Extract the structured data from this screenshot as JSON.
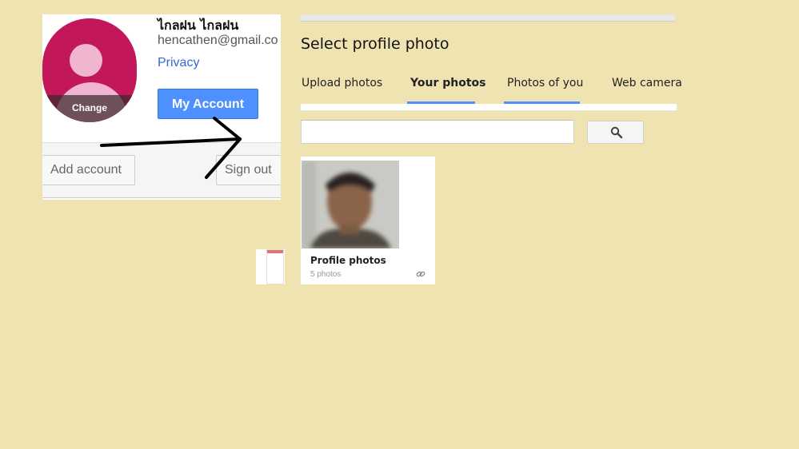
{
  "account": {
    "name": "ไกลฝน ไกลฝน",
    "email": "hencathen@gmail.co",
    "privacy_label": "Privacy",
    "my_account_label": "My Account",
    "avatar_change_label": "Change",
    "add_account_label": "Add account",
    "sign_out_label": "Sign out"
  },
  "dialog": {
    "title": "Select profile photo",
    "tabs": [
      {
        "label": "Upload photos",
        "active": false
      },
      {
        "label": "Your photos",
        "active": true
      },
      {
        "label": "Photos of you",
        "active": false
      },
      {
        "label": "Web camera",
        "active": false
      }
    ],
    "search": {
      "placeholder": "",
      "value": ""
    },
    "album": {
      "title": "Profile photos",
      "count": "5 photos"
    }
  },
  "colors": {
    "background": "#f0e3b2",
    "accent_blue": "#4d90fe",
    "avatar_bg": "#c2185b",
    "link": "#3367d6"
  },
  "icons": {
    "search": "magnifier-icon",
    "avatar": "default-person-icon",
    "album_link": "link-icon"
  }
}
